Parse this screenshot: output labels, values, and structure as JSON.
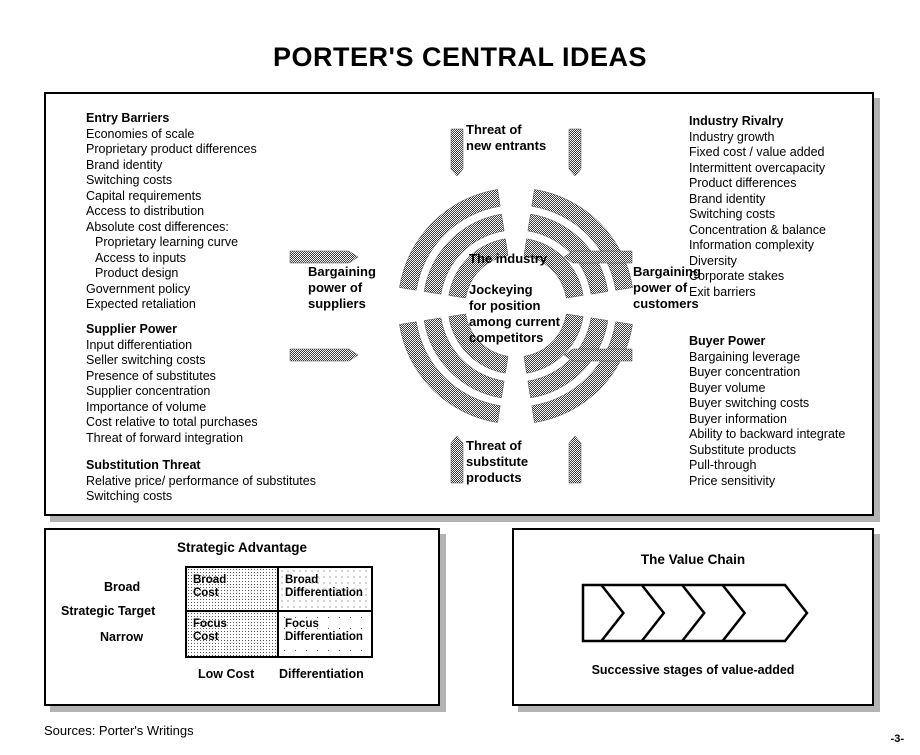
{
  "title": "PORTER'S CENTRAL IDEAS",
  "forces": {
    "entry_barriers": {
      "heading": "Entry Barriers",
      "items": [
        {
          "text": "Economies of scale",
          "indent": false
        },
        {
          "text": "Proprietary product differences",
          "indent": false
        },
        {
          "text": "Brand identity",
          "indent": false
        },
        {
          "text": "Switching costs",
          "indent": false
        },
        {
          "text": "Capital requirements",
          "indent": false
        },
        {
          "text": "Access to distribution",
          "indent": false
        },
        {
          "text": "Absolute cost differences:",
          "indent": false
        },
        {
          "text": "Proprietary learning curve",
          "indent": true
        },
        {
          "text": "Access to inputs",
          "indent": true
        },
        {
          "text": "Product design",
          "indent": true
        },
        {
          "text": "Government policy",
          "indent": false
        },
        {
          "text": "Expected retaliation",
          "indent": false
        }
      ]
    },
    "supplier_power": {
      "heading": "Supplier Power",
      "items": [
        {
          "text": "Input differentiation",
          "indent": false
        },
        {
          "text": "Seller switching costs",
          "indent": false
        },
        {
          "text": "Presence of substitutes",
          "indent": false
        },
        {
          "text": "Supplier concentration",
          "indent": false
        },
        {
          "text": "Importance of volume",
          "indent": false
        },
        {
          "text": "Cost relative to total purchases",
          "indent": false
        },
        {
          "text": "Threat of forward integration",
          "indent": false
        }
      ]
    },
    "substitution_threat": {
      "heading": "Substitution Threat",
      "items": [
        {
          "text": "Relative price/ performance of substitutes",
          "indent": false
        },
        {
          "text": "Switching costs",
          "indent": false
        }
      ]
    },
    "industry_rivalry": {
      "heading": "Industry Rivalry",
      "items": [
        {
          "text": "Industry growth",
          "indent": false
        },
        {
          "text": "Fixed cost / value added",
          "indent": false
        },
        {
          "text": "Intermittent overcapacity",
          "indent": false
        },
        {
          "text": "Product differences",
          "indent": false
        },
        {
          "text": "Brand identity",
          "indent": false
        },
        {
          "text": "Switching costs",
          "indent": false
        },
        {
          "text": "Concentration & balance",
          "indent": false
        },
        {
          "text": "Information complexity",
          "indent": false
        },
        {
          "text": "Diversity",
          "indent": false
        },
        {
          "text": "Corporate stakes",
          "indent": false
        },
        {
          "text": "Exit barriers",
          "indent": false
        }
      ]
    },
    "buyer_power": {
      "heading": "Buyer Power",
      "items": [
        {
          "text": "Bargaining leverage",
          "indent": false
        },
        {
          "text": "Buyer concentration",
          "indent": false
        },
        {
          "text": "Buyer volume",
          "indent": false
        },
        {
          "text": "Buyer switching costs",
          "indent": false
        },
        {
          "text": "Buyer information",
          "indent": false
        },
        {
          "text": "Ability to backward integrate",
          "indent": false
        },
        {
          "text": "Substitute products",
          "indent": false
        },
        {
          "text": "Pull-through",
          "indent": false
        },
        {
          "text": "Price sensitivity",
          "indent": false
        }
      ]
    }
  },
  "wheel": {
    "top_label_line1": "Threat of",
    "top_label_line2": "new entrants",
    "bottom_label_line1": "Threat of",
    "bottom_label_line2": "substitute",
    "bottom_label_line3": "products",
    "left_label_line1": "Bargaining",
    "left_label_line2": "power of",
    "left_label_line3": "suppliers",
    "right_label_line1": "Bargaining",
    "right_label_line2": "power of",
    "right_label_line3": "customers",
    "centre_heading": "The industry",
    "centre_line1": "Jockeying",
    "centre_line2": "for position",
    "centre_line3": "among current",
    "centre_line4": "competitors",
    "fill_color": "#6b6b6b"
  },
  "matrix": {
    "title": "Strategic Advantage",
    "axis_label": "Strategic Target",
    "row_labels": [
      "Broad",
      "Narrow"
    ],
    "column_labels": [
      "Low Cost",
      "Differentiation"
    ],
    "cells": [
      {
        "line1": "Broad",
        "line2": "Cost"
      },
      {
        "line1": "Broad",
        "line2": "Differentiation"
      },
      {
        "line1": "Focus",
        "line2": "Cost"
      },
      {
        "line1": "Focus",
        "line2": "Differentiation"
      }
    ]
  },
  "value_chain": {
    "title": "The Value Chain",
    "caption": "Successive stages of value-added",
    "segments": 5
  },
  "footer": {
    "sources": "Sources:  Porter's Writings",
    "page_number": "-3-"
  }
}
